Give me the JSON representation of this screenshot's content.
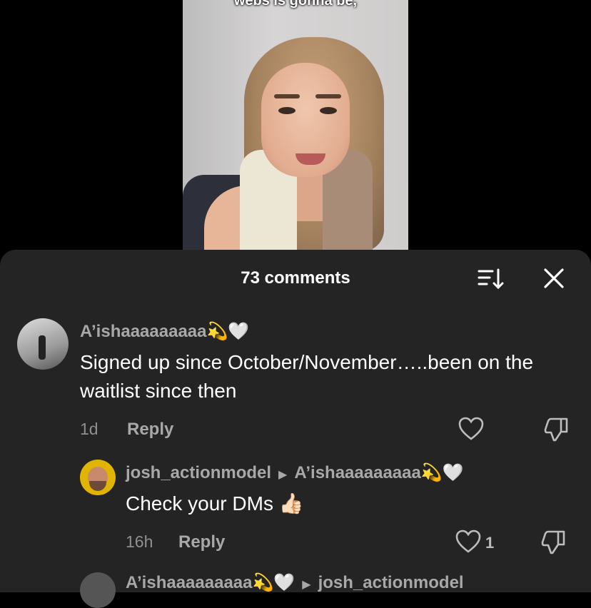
{
  "video": {
    "caption": "webs is gonna be,"
  },
  "comments_sheet": {
    "title": "73 comments",
    "sort_icon": "sort-icon",
    "close_icon": "close-icon"
  },
  "comments": [
    {
      "username": "A’ishaaaaaaaaa💫🤍",
      "text": "Signed up since October/November…..been on the waitlist since then",
      "time": "1d",
      "reply_label": "Reply",
      "like_count": ""
    },
    {
      "username": "josh_actionmodel",
      "reply_to": "A’ishaaaaaaaaa💫🤍",
      "text": "Check your DMs 👍🏻",
      "time": "16h",
      "reply_label": "Reply",
      "like_count": "1"
    },
    {
      "username": "A’ishaaaaaaaaa💫🤍",
      "reply_to": "josh_actionmodel"
    }
  ]
}
